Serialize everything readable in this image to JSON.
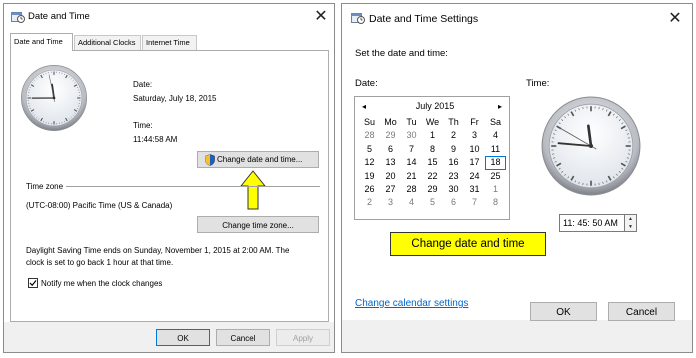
{
  "left_dialog": {
    "title": "Date and Time",
    "tabs": [
      "Date and Time",
      "Additional Clocks",
      "Internet Time"
    ],
    "date_label": "Date:",
    "date_value": "Saturday, July 18, 2015",
    "time_label": "Time:",
    "time_value": "11:44:58 AM",
    "change_datetime_button": "Change date and time...",
    "time_zone_label": "Time zone",
    "time_zone_value": "(UTC-08:00) Pacific Time (US & Canada)",
    "change_timezone_button": "Change time zone...",
    "dst_line1": "Daylight Saving Time ends on Sunday, November 1, 2015 at 2:00 AM. The",
    "dst_line2": "clock is set to go back 1 hour at that time.",
    "notify_checkbox_label": "Notify me when the clock changes",
    "notify_checked": true,
    "ok_button": "OK",
    "cancel_button": "Cancel",
    "apply_button": "Apply",
    "clock": {
      "hour": 11,
      "minute": 44,
      "second": 58
    }
  },
  "right_dialog": {
    "title": "Date and Time Settings",
    "instruction": "Set the date and time:",
    "date_label": "Date:",
    "time_label": "Time:",
    "calendar": {
      "month_title": "July 2015",
      "prev_arrow": "◂",
      "next_arrow": "▸",
      "weekdays": [
        "Su",
        "Mo",
        "Tu",
        "We",
        "Th",
        "Fr",
        "Sa"
      ],
      "weeks": [
        [
          "28",
          "29",
          "30",
          "1",
          "2",
          "3",
          "4"
        ],
        [
          "5",
          "6",
          "7",
          "8",
          "9",
          "10",
          "11"
        ],
        [
          "12",
          "13",
          "14",
          "15",
          "16",
          "17",
          "18"
        ],
        [
          "19",
          "20",
          "21",
          "22",
          "23",
          "24",
          "25"
        ],
        [
          "26",
          "27",
          "28",
          "29",
          "30",
          "31",
          "1"
        ],
        [
          "2",
          "3",
          "4",
          "5",
          "6",
          "7",
          "8"
        ]
      ],
      "selected_day": "18"
    },
    "time_input_value": "11: 45: 50 AM",
    "callout_text": "Change date and time",
    "change_calendar_link": "Change calendar settings",
    "ok_button": "OK",
    "cancel_button": "Cancel",
    "clock": {
      "hour": 11,
      "minute": 45,
      "second": 50
    }
  },
  "colors": {
    "accent_border": "#0078d7",
    "link": "#0066cc",
    "callout_fill": "#ffff00",
    "arrow_fill": "#ffff00"
  },
  "icons": [
    "calendar-clock-icon",
    "close-icon",
    "shield-icon",
    "up-arrow-icon",
    "checkbox-check-icon",
    "spin-up-icon",
    "spin-down-icon"
  ]
}
